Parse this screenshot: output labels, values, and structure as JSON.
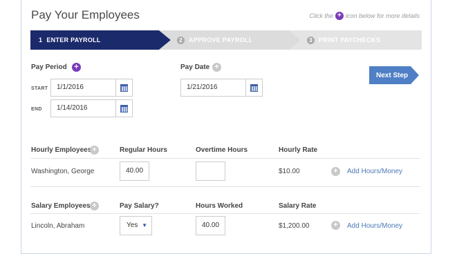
{
  "header": {
    "title": "Pay Your Employees",
    "hint_prefix": "Click the",
    "hint_suffix": "icon below for more details"
  },
  "steps": [
    {
      "number": "1",
      "label": "ENTER PAYROLL",
      "state": "active"
    },
    {
      "number": "2",
      "label": "APPROVE PAYROLL",
      "state": "inactive"
    },
    {
      "number": "3",
      "label": "PRINT PAYCHECKS",
      "state": "inactive"
    }
  ],
  "pay_period": {
    "label": "Pay Period",
    "start_label": "START",
    "start_value": "1/1/2016",
    "end_label": "END",
    "end_value": "1/14/2016"
  },
  "pay_date": {
    "label": "Pay Date",
    "value": "1/21/2016"
  },
  "next_button": "Next Step",
  "hourly": {
    "headers": [
      "Hourly Employees",
      "Regular Hours",
      "Overtime Hours",
      "Hourly Rate"
    ],
    "rows": [
      {
        "name": "Washington, George",
        "regular_hours": "40.00",
        "overtime_hours": "",
        "rate": "$10.00",
        "action": "Add Hours/Money"
      }
    ]
  },
  "salary": {
    "headers": [
      "Salary Employees",
      "Pay Salary?",
      "Hours Worked",
      "Salary Rate"
    ],
    "rows": [
      {
        "name": "Lincoln, Abraham",
        "pay_salary": "Yes",
        "hours_worked": "40.00",
        "rate": "$1,200.00",
        "action": "Add Hours/Money"
      }
    ]
  },
  "colors": {
    "active_step": "#1b2a6b",
    "inactive_step": "#dcdcdc",
    "accent_purple": "#7a3bb8",
    "next_button": "#4f7fc4",
    "link": "#4b79b8"
  }
}
